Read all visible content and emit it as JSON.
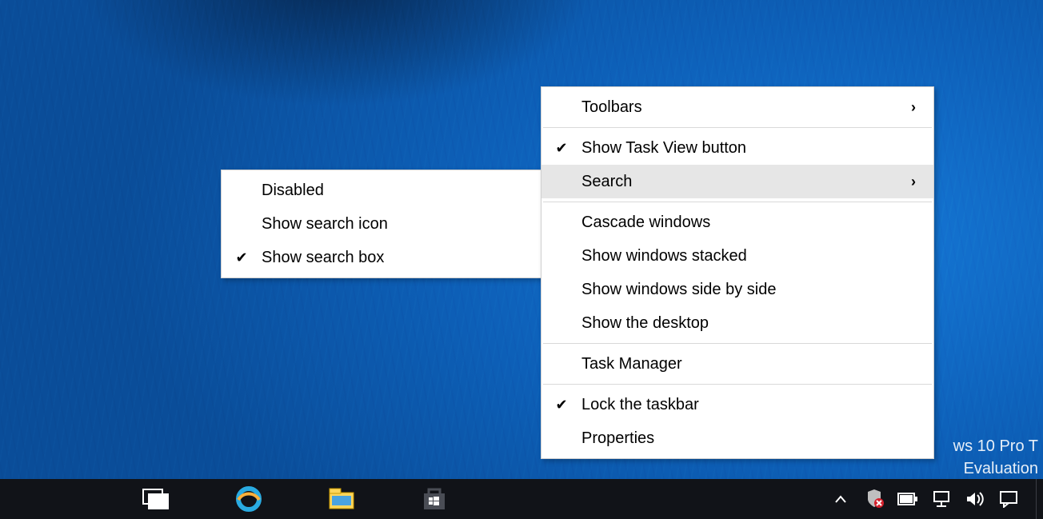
{
  "watermark": {
    "line1": "ws 10 Pro T",
    "line2": "Evaluation"
  },
  "mainMenu": {
    "toolbars": "Toolbars",
    "showTaskView": "Show Task View button",
    "search": "Search",
    "cascade": "Cascade windows",
    "stacked": "Show windows stacked",
    "sideBySide": "Show windows side by side",
    "showDesktop": "Show the desktop",
    "taskManager": "Task Manager",
    "lockTaskbar": "Lock the taskbar",
    "properties": "Properties"
  },
  "subMenu": {
    "disabled": "Disabled",
    "showIcon": "Show search icon",
    "showBox": "Show search box"
  }
}
